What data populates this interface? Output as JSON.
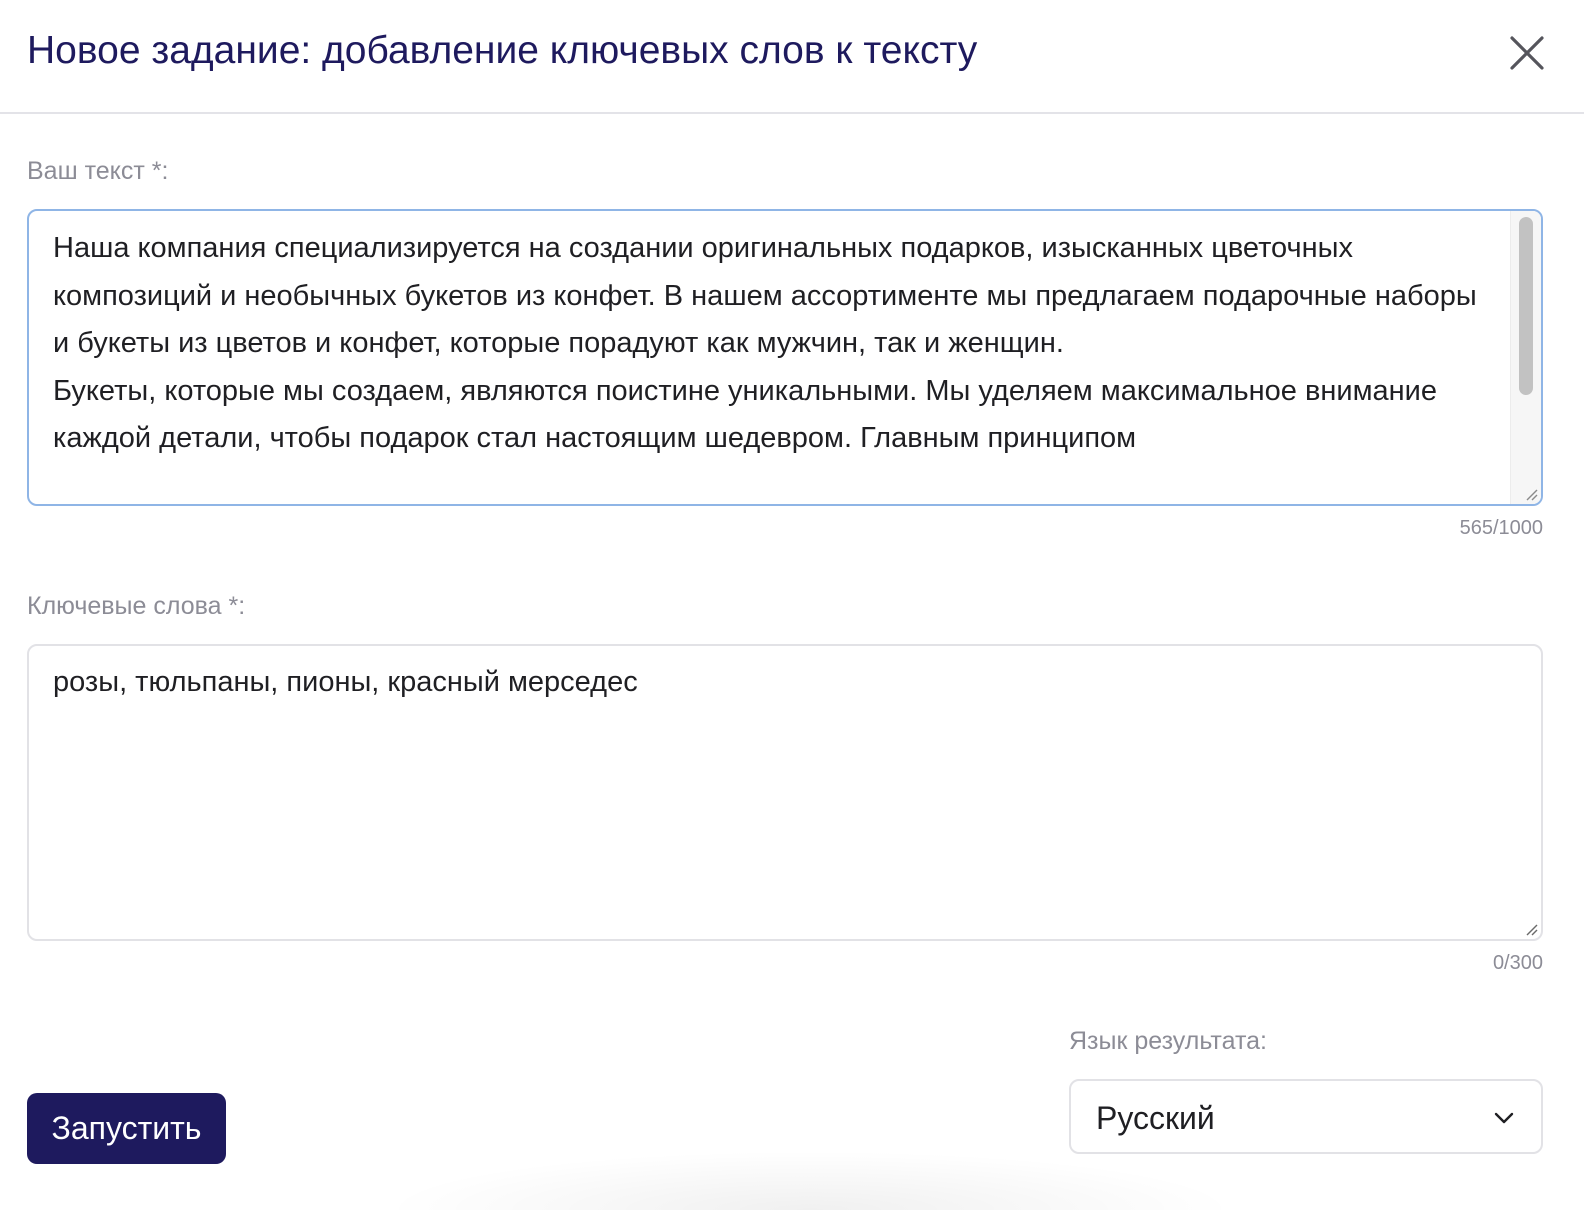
{
  "dialog": {
    "title": "Новое задание: добавление ключевых слов к тексту",
    "close_icon": "close-icon"
  },
  "text_field": {
    "label": "Ваш текст *:",
    "value": "Наша компания специализируется на создании оригинальных подарков, изысканных цветочных композиций и необычных букетов из конфет. В нашем ассортименте мы предлагаем подарочные наборы и букеты из цветов и конфет, которые порадуют как мужчин, так и женщин.\nБукеты, которые мы создаем, являются поистине уникальными. Мы уделяем максимальное внимание каждой детали, чтобы подарок стал настоящим шедевром. Главным принципом",
    "counter": "565/1000"
  },
  "keywords_field": {
    "label": "Ключевые слова *:",
    "value": "розы, тюльпаны, пионы, красный мерседес",
    "counter": "0/300"
  },
  "language": {
    "label": "Язык результата:",
    "selected": "Русский",
    "icon": "chevron-down-icon"
  },
  "actions": {
    "run_label": "Запустить"
  },
  "colors": {
    "primary": "#1e1a5e",
    "focus_border": "#8fb5e6",
    "muted_text": "#8c8c96"
  }
}
